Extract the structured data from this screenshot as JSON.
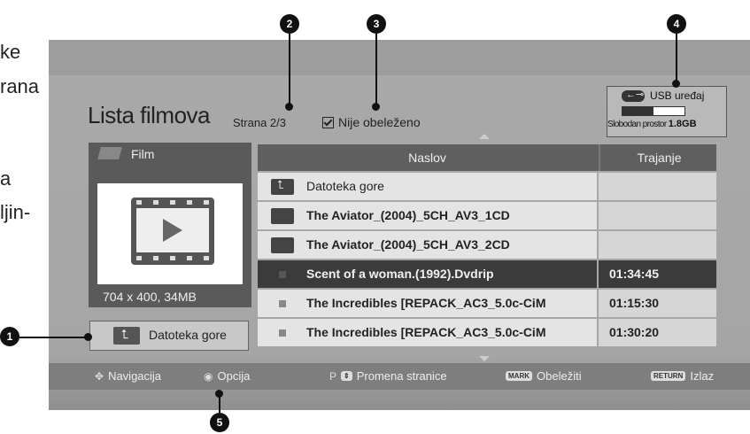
{
  "page_fragments": [
    "ke",
    "rana",
    "a",
    "ljin-"
  ],
  "screen": {
    "title": "Lista filmova",
    "page_indicator": "Strana 2/3",
    "unmarked_label": "Nije obeleženo",
    "usb": {
      "label": "USB uređaj",
      "free_label": "Slobodan prostor",
      "free_value": "1.8GB",
      "used_fraction": 0.5
    },
    "preview": {
      "category": "Film",
      "resolution": "704 x 400, 34MB"
    },
    "up_folder_button": "Datoteka gore",
    "table": {
      "columns": [
        "Naslov",
        "Trajanje"
      ],
      "rows": [
        {
          "name": "Datoteka gore",
          "duration": "",
          "type": "up-folder",
          "bold": false,
          "selected": false
        },
        {
          "name": "The Aviator_(2004)_5CH_AV3_1CD",
          "duration": "",
          "type": "folder",
          "bold": true,
          "selected": false
        },
        {
          "name": "The Aviator_(2004)_5CH_AV3_2CD",
          "duration": "",
          "type": "folder",
          "bold": true,
          "selected": false
        },
        {
          "name": "Scent of a woman.(1992).Dvdrip",
          "duration": "01:34:45",
          "type": "file",
          "bold": true,
          "selected": true
        },
        {
          "name": "The Incredibles [REPACK_AC3_5.0c-CiM",
          "duration": "01:15:30",
          "type": "file",
          "bold": true,
          "selected": false
        },
        {
          "name": "The Incredibles [REPACK_AC3_5.0c-CiM",
          "duration": "01:30:20",
          "type": "file",
          "bold": true,
          "selected": false
        }
      ]
    },
    "bottom_bar": {
      "navigation": "Navigacija",
      "option": "Opcija",
      "page_key": "P",
      "page_change": "Promena stranice",
      "mark_key": "MARK",
      "mark": "Obeležiti",
      "return_key": "RETURN",
      "exit": "Izlaz"
    }
  },
  "callouts": [
    "1",
    "2",
    "3",
    "4",
    "5"
  ]
}
